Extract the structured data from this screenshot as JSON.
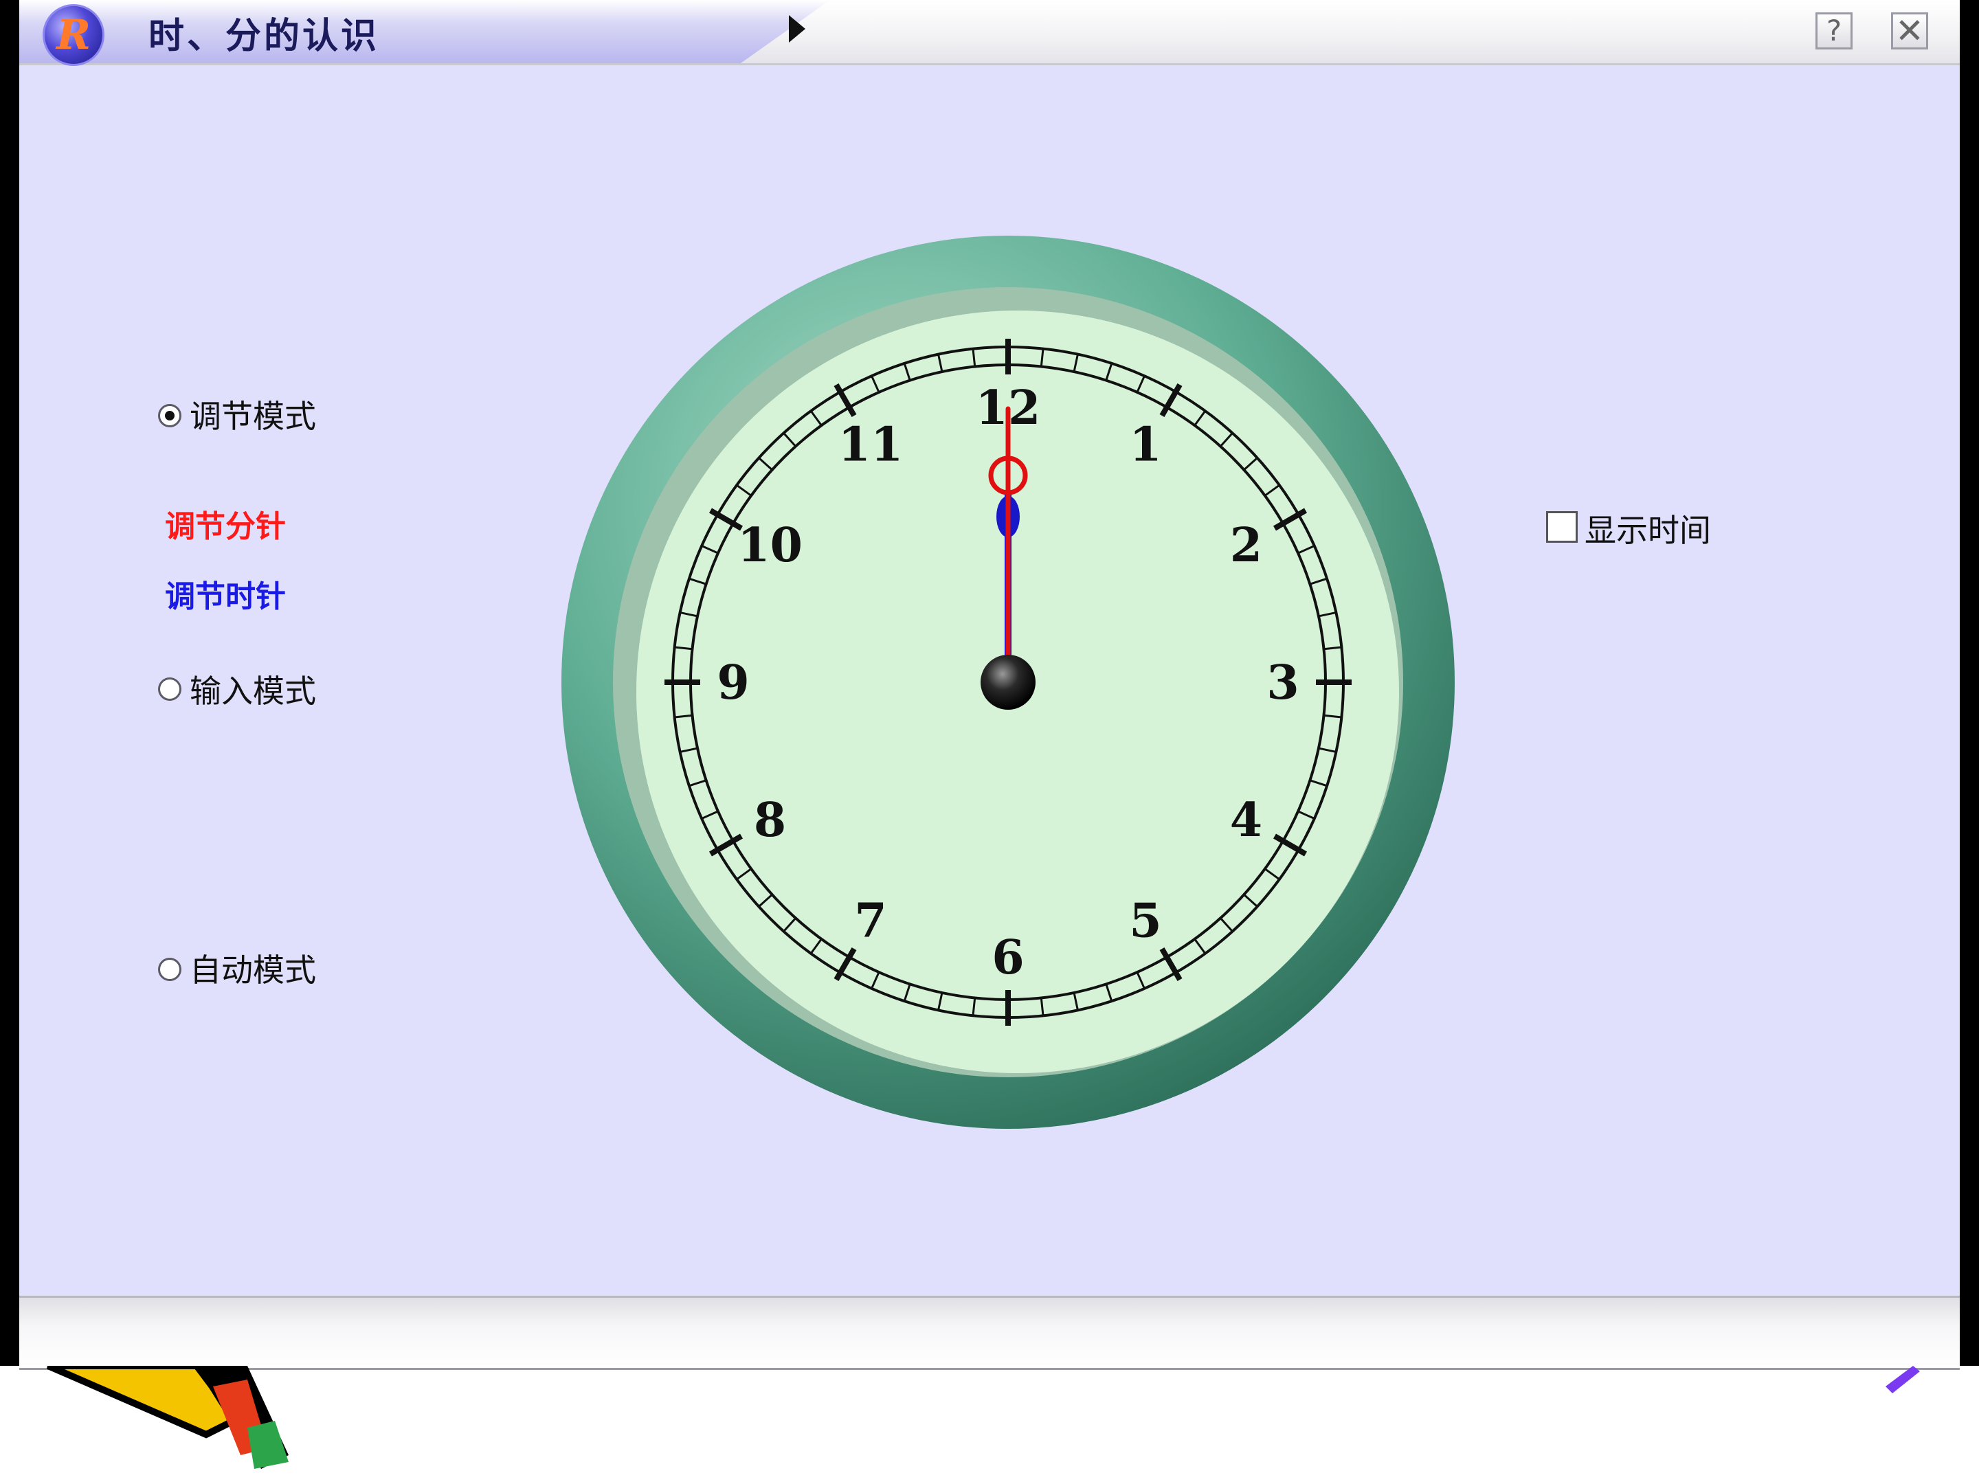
{
  "window": {
    "title": "时、分的认识",
    "logo_letter": "R",
    "help_label": "?",
    "close_label": "✕"
  },
  "controls": {
    "adjust_mode": {
      "label": "调节模式",
      "selected": true
    },
    "adjust_minute": {
      "label": "调节分针",
      "color": "#ff1a1a"
    },
    "adjust_hour": {
      "label": "调节时针",
      "color": "#1a1ae6"
    },
    "input_mode": {
      "label": "输入模式",
      "selected": false
    },
    "auto_mode": {
      "label": "自动模式",
      "selected": false
    },
    "show_time": {
      "label": "显示时间",
      "checked": false
    }
  },
  "clock": {
    "numerals": [
      "12",
      "1",
      "2",
      "3",
      "4",
      "5",
      "6",
      "7",
      "8",
      "9",
      "10",
      "11"
    ],
    "hour": 12,
    "minute": 0,
    "minute_hand_color": "#e01010",
    "hour_hand_color": "#1010d0",
    "rim_color": "#4a9a80",
    "face_color": "#d6f3d8"
  },
  "icons": [
    "logo-icon",
    "play-icon",
    "help-icon",
    "close-icon",
    "pencil-clipart"
  ]
}
